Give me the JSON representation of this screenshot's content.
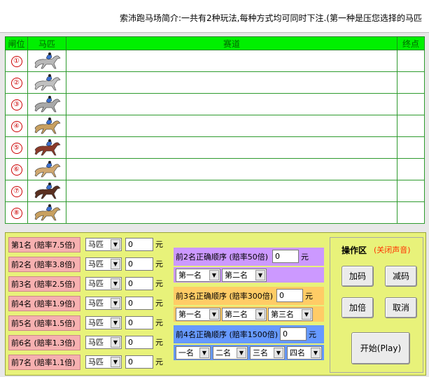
{
  "banner": {
    "text": "索沛跑马场简介:一共有2种玩法,每种方式均可同时下注.(第一种是压您选择的马匹"
  },
  "track": {
    "headers": [
      "闸位",
      "马匹",
      "赛道",
      "终点"
    ],
    "lanes": [
      "①",
      "②",
      "③",
      "④",
      "⑤",
      "⑥",
      "⑦",
      "⑧"
    ],
    "horse_colors": [
      "#b8b8b8",
      "#c0c0c0",
      "#a8a8a8",
      "#c8a060",
      "#8b3a2a",
      "#d0a870",
      "#5a3020",
      "#c8a060"
    ]
  },
  "bets": {
    "select_label": "马匹",
    "unit": "元",
    "rows": [
      {
        "label": "第1名 (赔率7.5倍)",
        "value": "0"
      },
      {
        "label": "前2名 (赔率3.8倍)",
        "value": "0"
      },
      {
        "label": "前3名 (赔率2.5倍)",
        "value": "0"
      },
      {
        "label": "前4名 (赔率1.9倍)",
        "value": "0"
      },
      {
        "label": "前5名 (赔率1.5倍)",
        "value": "0"
      },
      {
        "label": "前6名 (赔率1.3倍)",
        "value": "0"
      },
      {
        "label": "前7名 (赔率1.1倍)",
        "value": "0"
      }
    ]
  },
  "order": {
    "unit": "元",
    "two": {
      "label": "前2名正确顺序 (赔率50倍)",
      "value": "0",
      "selects": [
        "第一名",
        "第二名"
      ]
    },
    "three": {
      "label": "前3名正确顺序 (赔率300倍)",
      "value": "0",
      "selects": [
        "第一名",
        "第二名",
        "第三名"
      ]
    },
    "four": {
      "label": "前4名正确顺序 (赔率1500倍)",
      "value": "0",
      "selects": [
        "一名",
        "二名",
        "三名",
        "四名"
      ]
    }
  },
  "ops": {
    "title": "操作区",
    "mute": "(关闭声音)",
    "add": "加码",
    "sub": "减码",
    "double": "加倍",
    "cancel": "取消",
    "start": "开始(Play)"
  }
}
